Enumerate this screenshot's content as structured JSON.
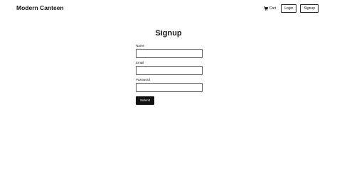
{
  "navbar": {
    "brand": "Modern Canteen",
    "cart_label": "Cart",
    "cart_icon": "cart-icon",
    "login_label": "Login",
    "signup_label": "Signup"
  },
  "page": {
    "title": "Signup"
  },
  "form": {
    "name_label": "Name",
    "name_value": "",
    "email_label": "Email",
    "email_value": "",
    "password_label": "Password",
    "password_value": "",
    "submit_label": "Submit"
  },
  "colors": {
    "text": "#111111",
    "button_bg": "#111111",
    "button_text": "#ffffff",
    "background": "#ffffff"
  }
}
